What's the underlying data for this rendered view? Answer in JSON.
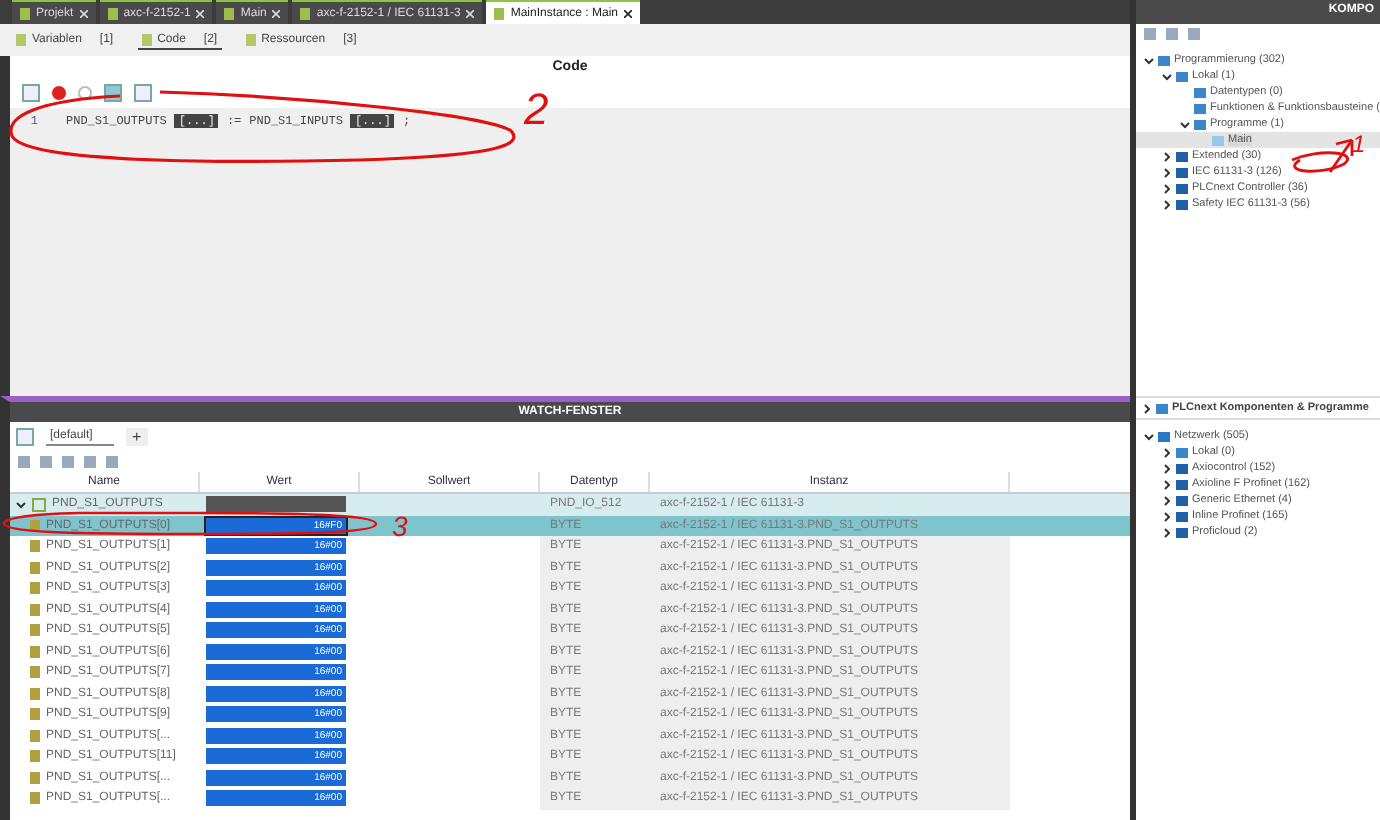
{
  "editor_tabs": [
    {
      "label": "Projekt",
      "selected": false
    },
    {
      "label": "axc-f-2152-1",
      "selected": false
    },
    {
      "label": "Main",
      "selected": false
    },
    {
      "label": "axc-f-2152-1 / IEC 61131-3",
      "selected": false
    },
    {
      "label": "MainInstance : Main",
      "selected": true
    }
  ],
  "sub_tabs": [
    {
      "label": "Variablen",
      "count": "[1]",
      "selected": false
    },
    {
      "label": "Code",
      "count": "[2]",
      "selected": true
    },
    {
      "label": "Ressourcen",
      "count": "[3]",
      "selected": false
    }
  ],
  "code": {
    "title": "Code",
    "lines": [
      {
        "number": "1",
        "target": "PND_S1_OUTPUTS",
        "op": ":=",
        "source": "PND_S1_INPUTS",
        "ellipsis": "[...]",
        "end": ";"
      }
    ]
  },
  "watch": {
    "title": "WATCH-FENSTER",
    "tab": "[default]",
    "add": "+",
    "columns": [
      "Name",
      "Wert",
      "Sollwert",
      "Datentyp",
      "Instanz"
    ],
    "rows": [
      {
        "kind": "struct",
        "expanded": true,
        "selected": false,
        "name": "PND_S1_OUTPUTS",
        "value": "",
        "datatype": "PND_IO_512",
        "instance": "axc-f-2152-1 / IEC 61131-3"
      },
      {
        "kind": "element",
        "selected": true,
        "name": "PND_S1_OUTPUTS[0]",
        "value": "16#F0",
        "datatype": "BYTE",
        "instance": "axc-f-2152-1 / IEC 61131-3.PND_S1_OUTPUTS"
      },
      {
        "kind": "element",
        "selected": false,
        "name": "PND_S1_OUTPUTS[1]",
        "value": "16#00",
        "datatype": "BYTE",
        "instance": "axc-f-2152-1 / IEC 61131-3.PND_S1_OUTPUTS"
      },
      {
        "kind": "element",
        "selected": false,
        "name": "PND_S1_OUTPUTS[2]",
        "value": "16#00",
        "datatype": "BYTE",
        "instance": "axc-f-2152-1 / IEC 61131-3.PND_S1_OUTPUTS"
      },
      {
        "kind": "element",
        "selected": false,
        "name": "PND_S1_OUTPUTS[3]",
        "value": "16#00",
        "datatype": "BYTE",
        "instance": "axc-f-2152-1 / IEC 61131-3.PND_S1_OUTPUTS"
      },
      {
        "kind": "element",
        "selected": false,
        "name": "PND_S1_OUTPUTS[4]",
        "value": "16#00",
        "datatype": "BYTE",
        "instance": "axc-f-2152-1 / IEC 61131-3.PND_S1_OUTPUTS"
      },
      {
        "kind": "element",
        "selected": false,
        "name": "PND_S1_OUTPUTS[5]",
        "value": "16#00",
        "datatype": "BYTE",
        "instance": "axc-f-2152-1 / IEC 61131-3.PND_S1_OUTPUTS"
      },
      {
        "kind": "element",
        "selected": false,
        "name": "PND_S1_OUTPUTS[6]",
        "value": "16#00",
        "datatype": "BYTE",
        "instance": "axc-f-2152-1 / IEC 61131-3.PND_S1_OUTPUTS"
      },
      {
        "kind": "element",
        "selected": false,
        "name": "PND_S1_OUTPUTS[7]",
        "value": "16#00",
        "datatype": "BYTE",
        "instance": "axc-f-2152-1 / IEC 61131-3.PND_S1_OUTPUTS"
      },
      {
        "kind": "element",
        "selected": false,
        "name": "PND_S1_OUTPUTS[8]",
        "value": "16#00",
        "datatype": "BYTE",
        "instance": "axc-f-2152-1 / IEC 61131-3.PND_S1_OUTPUTS"
      },
      {
        "kind": "element",
        "selected": false,
        "name": "PND_S1_OUTPUTS[9]",
        "value": "16#00",
        "datatype": "BYTE",
        "instance": "axc-f-2152-1 / IEC 61131-3.PND_S1_OUTPUTS"
      },
      {
        "kind": "element",
        "selected": false,
        "name": "PND_S1_OUTPUTS[...",
        "value": "16#00",
        "datatype": "BYTE",
        "instance": "axc-f-2152-1 / IEC 61131-3.PND_S1_OUTPUTS"
      },
      {
        "kind": "element",
        "selected": false,
        "name": "PND_S1_OUTPUTS[11]",
        "value": "16#00",
        "datatype": "BYTE",
        "instance": "axc-f-2152-1 / IEC 61131-3.PND_S1_OUTPUTS"
      },
      {
        "kind": "element",
        "selected": false,
        "name": "PND_S1_OUTPUTS[...",
        "value": "16#00",
        "datatype": "BYTE",
        "instance": "axc-f-2152-1 / IEC 61131-3.PND_S1_OUTPUTS"
      },
      {
        "kind": "element",
        "selected": false,
        "name": "PND_S1_OUTPUTS[...",
        "value": "16#00",
        "datatype": "BYTE",
        "instance": "axc-f-2152-1 / IEC 61131-3.PND_S1_OUTPUTS"
      }
    ]
  },
  "components": {
    "title": "KOMPO",
    "tree": [
      {
        "label": "Programmierung (302)",
        "kind": "folder",
        "expanded": true,
        "selected": false,
        "children": [
          {
            "label": "Lokal (1)",
            "kind": "folder",
            "expanded": true,
            "selected": false,
            "children": [
              {
                "label": "Datentypen (0)",
                "kind": "folder",
                "selected": false
              },
              {
                "label": "Funktionen & Funktionsbausteine (",
                "kind": "folder",
                "selected": false
              },
              {
                "label": "Programme (1)",
                "kind": "folder",
                "expanded": true,
                "selected": false,
                "children": [
                  {
                    "label": "Main",
                    "kind": "program",
                    "selected": true
                  }
                ]
              }
            ]
          },
          {
            "label": "Extended (30)",
            "kind": "library",
            "expanded": false,
            "selected": false
          },
          {
            "label": "IEC 61131-3 (126)",
            "kind": "library",
            "expanded": false,
            "selected": false
          },
          {
            "label": "PLCnext Controller (36)",
            "kind": "library",
            "expanded": false,
            "selected": false
          },
          {
            "label": "Safety IEC 61131-3 (56)",
            "kind": "library",
            "expanded": false,
            "selected": false
          }
        ]
      }
    ],
    "section": {
      "label": "PLCnext Komponenten & Programme",
      "expanded": false
    },
    "network": [
      {
        "label": "Netzwerk (505)",
        "kind": "network",
        "expanded": true,
        "selected": false,
        "children": [
          {
            "label": "Lokal (0)",
            "kind": "folder",
            "expanded": false,
            "selected": false
          },
          {
            "label": "Axiocontrol (152)",
            "kind": "library",
            "expanded": false,
            "selected": false
          },
          {
            "label": "Axioline F Profinet (162)",
            "kind": "library",
            "expanded": false,
            "selected": false
          },
          {
            "label": "Generic Ethernet (4)",
            "kind": "library",
            "expanded": false,
            "selected": false
          },
          {
            "label": "Inline Profinet (165)",
            "kind": "library",
            "expanded": false,
            "selected": false
          },
          {
            "label": "Proficloud (2)",
            "kind": "library",
            "expanded": false,
            "selected": false
          }
        ]
      }
    ]
  },
  "annotations": [
    {
      "label": "2"
    },
    {
      "label": "3"
    },
    {
      "label": "1"
    }
  ]
}
